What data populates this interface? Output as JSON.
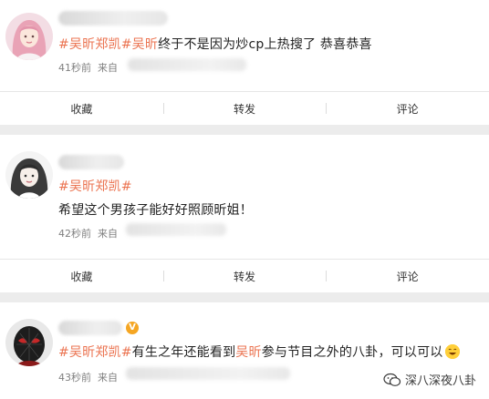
{
  "posts": [
    {
      "hashtag": "#吴昕郑凯#",
      "mention": "吴昕",
      "text": "终于不是因为炒cp上热搜了 恭喜恭喜",
      "time": "41秒前",
      "source_prefix": "来自",
      "avatar_icon": "avatar-girl-pink-icon"
    },
    {
      "hashtag": "#吴昕郑凯#",
      "text": "希望这个男孩子能好好照顾昕姐！",
      "time": "42秒前",
      "source_prefix": "来自",
      "avatar_icon": "avatar-girl-bw-icon"
    },
    {
      "hashtag": "#吴昕郑凯#",
      "text_before": "有生之年还能看到",
      "mention": "吴昕",
      "text_after": "参与节目之外的八卦，可以可以",
      "time": "43秒前",
      "source_prefix": "来自",
      "avatar_icon": "avatar-spiderman-icon",
      "badge": "V"
    }
  ],
  "actions": {
    "favorite": "收藏",
    "repost": "转发",
    "comment": "评论"
  },
  "watermark": "深八深夜八卦",
  "colors": {
    "hashtag": "#eb7350",
    "background": "#ececec",
    "card": "#ffffff"
  }
}
